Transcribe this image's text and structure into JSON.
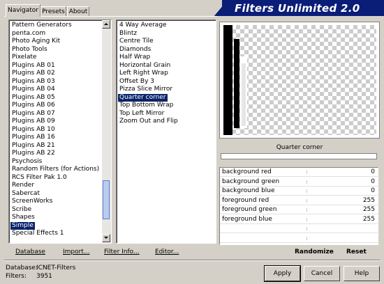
{
  "tabs": [
    {
      "label": "Navigator",
      "active": true
    },
    {
      "label": "Presets",
      "active": false
    },
    {
      "label": "About",
      "active": false
    }
  ],
  "title": "Filters Unlimited 2.0",
  "categories": {
    "items": [
      "Pattern Generators",
      "penta.com",
      "Photo Aging Kit",
      "Photo Tools",
      "Pixelate",
      "Plugins AB 01",
      "Plugins AB 02",
      "Plugins AB 03",
      "Plugins AB 04",
      "Plugins AB 05",
      "Plugins AB 06",
      "Plugins AB 07",
      "Plugins AB 09",
      "Plugins AB 10",
      "Plugins AB 16",
      "Plugins AB 21",
      "Plugins AB 22",
      "Psychosis",
      "Random Filters (for Actions)",
      "RCS Filter Pak 1.0",
      "Render",
      "Sabercat",
      "ScreenWorks",
      "Scribe",
      "Shapes",
      "Simple",
      "Special Effects 1"
    ],
    "selected_index": 25
  },
  "filters": {
    "items": [
      "4 Way Average",
      "Blintz",
      "Centre Tile",
      "Diamonds",
      "Half Wrap",
      "Horizontal Grain",
      "Left Right Wrap",
      "Offset By 3",
      "Pizza Slice Mirror",
      "Quarter corner",
      "Top Bottom Wrap",
      "Top Left Mirror",
      "Zoom Out and Flip"
    ],
    "selected_index": 9
  },
  "bottom_buttons": {
    "database": "Database",
    "import": "Import...",
    "filter_info": "Filter Info...",
    "editor": "Editor...",
    "randomize": "Randomize",
    "reset": "Reset"
  },
  "preview": {
    "filter_name": "Quarter corner"
  },
  "parameters": [
    {
      "label": "background red",
      "value": "0"
    },
    {
      "label": "background green",
      "value": "0"
    },
    {
      "label": "background blue",
      "value": "0"
    },
    {
      "label": "foreground red",
      "value": "255"
    },
    {
      "label": "foreground green",
      "value": "255"
    },
    {
      "label": "foreground blue",
      "value": "255"
    },
    {
      "label": "",
      "value": ""
    },
    {
      "label": "",
      "value": ""
    }
  ],
  "status": {
    "database_label": "Database:",
    "database_value": "ICNET-Filters",
    "filters_label": "Filters:",
    "filters_value": "3951"
  },
  "dialog_buttons": {
    "apply": "Apply",
    "cancel": "Cancel",
    "help": "Help"
  },
  "colors": {
    "title_bar": "#0a1d77",
    "selection": "#0a246a",
    "face": "#d4d0c8"
  }
}
